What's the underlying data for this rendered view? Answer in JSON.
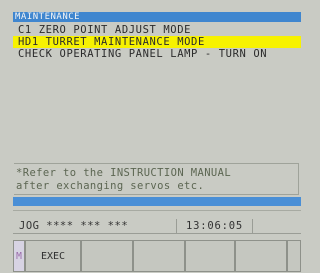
{
  "header": {
    "title": "MAINTENANCE"
  },
  "menu": {
    "items": [
      {
        "label": "C1 ZERO POINT ADJUST MODE"
      },
      {
        "label": "HD1 TURRET MAINTENANCE MODE"
      },
      {
        "label": "CHECK OPERATING PANEL LAMP - TURN ON"
      }
    ],
    "selected_index": 1,
    "highlight_color": "#f7f200"
  },
  "note": {
    "line1": "*Refer to the INSTRUCTION MANUAL",
    "line2": " after exchanging servos etc."
  },
  "status": {
    "mode": "JOG **** *** ***",
    "time": "13:06:05"
  },
  "softkeys": {
    "m_label": "M",
    "exec_label": "EXEC",
    "blank_count": 5
  },
  "colors": {
    "title_bar": "#3f86cf",
    "accent_bar": "#4a8fd6",
    "background": "#c9cbc4"
  }
}
